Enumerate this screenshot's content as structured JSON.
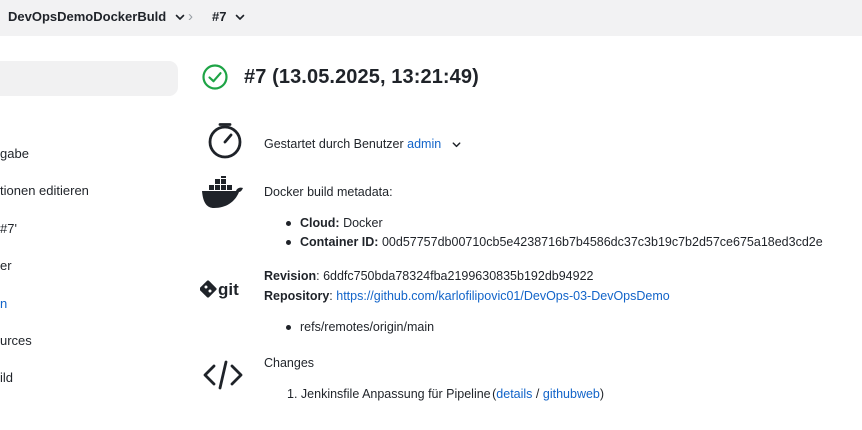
{
  "breadcrumb": {
    "job": "DevOpsDemoDockerBuld",
    "build": "#7"
  },
  "sidebar": {
    "items": [
      {
        "label": "gabe",
        "link": false
      },
      {
        "label": "tionen editieren",
        "link": false
      },
      {
        "label": "#7'",
        "link": false
      },
      {
        "label": "er",
        "link": false
      },
      {
        "label": "n",
        "link": true
      },
      {
        "label": "urces",
        "link": false
      },
      {
        "label": "ild",
        "link": false
      }
    ]
  },
  "build": {
    "title": "#7 (13.05.2025, 13:21:49)",
    "status_icon": "check-circle-icon",
    "status_color": "#1ea446"
  },
  "started": {
    "text": "Gestartet durch Benutzer",
    "user": "admin"
  },
  "docker": {
    "heading": "Docker build metadata:",
    "items": [
      {
        "key": "Cloud:",
        "value": "Docker"
      },
      {
        "key": "Container ID:",
        "value": "00d57757db00710cb5e4238716b7b4586dc37c3b19c7b2d57ce675a18ed3cd2e"
      }
    ]
  },
  "git": {
    "logo_text": "git",
    "revision_label": "Revision",
    "revision": "6ddfc750bda78324fba2199630835b192db94922",
    "repository_label": "Repository",
    "repository": "https://github.com/karlofilipovic01/DevOps-03-DevOpsDemo",
    "branches": [
      "refs/remotes/origin/main"
    ]
  },
  "changes": {
    "heading": "Changes",
    "items": [
      {
        "index": "1.",
        "text": "Jenkinsfile Anpassung für Pipeline",
        "open": "(",
        "details": "details",
        "sep": "/",
        "githubweb": "githubweb",
        "close": ")"
      }
    ]
  },
  "colors": {
    "accent": "#1264c9",
    "topbar": "#f2f2f3",
    "success": "#1ea446"
  }
}
